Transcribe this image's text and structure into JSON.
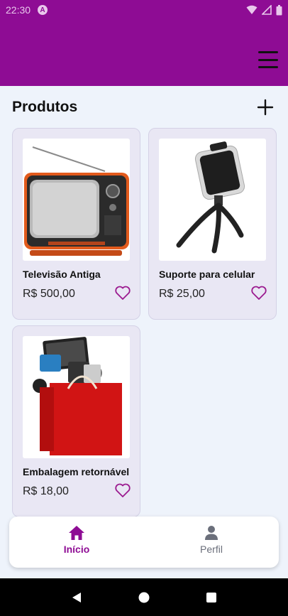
{
  "status": {
    "time": "22:30",
    "app_badge": "A"
  },
  "header": {
    "menu_icon": "hamburger-menu-icon"
  },
  "section": {
    "title": "Produtos",
    "add_icon": "plus-icon"
  },
  "products": [
    {
      "name": "Televisão Antiga",
      "price": "R$ 500,00",
      "image": "old-tv-image",
      "favorite": false
    },
    {
      "name": "Suporte para celular",
      "price": "R$ 25,00",
      "image": "phone-tripod-image",
      "favorite": false
    },
    {
      "name": "Embalagem retornável",
      "price": "R$ 18,00",
      "image": "shopping-bag-electronics-image",
      "favorite": false
    }
  ],
  "nav": [
    {
      "label": "Início",
      "icon": "home-icon",
      "active": true
    },
    {
      "label": "Perfil",
      "icon": "person-icon",
      "active": false
    }
  ],
  "colors": {
    "primary": "#8e0c94",
    "background": "#eef3fb",
    "card": "#e9e7f4",
    "inactive": "#6b6f7b"
  }
}
